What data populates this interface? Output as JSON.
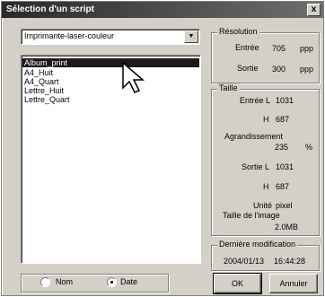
{
  "window": {
    "title": "Sélection d'un script",
    "close": "x"
  },
  "printer": {
    "selected": "Imprimante-laser-couleur"
  },
  "scripts": [
    "Album_print",
    "A4_Huit",
    "A4_Quart",
    "Lettre_Huit",
    "Lettre_Quart"
  ],
  "resolution": {
    "legend": "Résolution",
    "input_label": "Entrée",
    "input_value": "705",
    "input_unit": "ppp",
    "output_label": "Sortie",
    "output_value": "300",
    "output_unit": "ppp"
  },
  "size": {
    "legend": "Taille",
    "input_l_label": "Entrée L",
    "input_l_value": "1031",
    "input_h_label": "H",
    "input_h_value": "687",
    "enlarge_label": "Agrandissement",
    "enlarge_value": "235",
    "enlarge_unit": "%",
    "output_l_label": "Sortie L",
    "output_l_value": "1031",
    "output_h_label": "H",
    "output_h_value": "687",
    "unit_label": "Unité",
    "unit_value": "pixel",
    "image_size_label": "Taille de l'image",
    "image_size_value": "2.0MB"
  },
  "modified": {
    "legend": "Dernière modification",
    "date": "2004/01/13",
    "time": "16:44:28"
  },
  "sort": {
    "name_label": "Nom",
    "date_label": "Date",
    "selected": "Date"
  },
  "buttons": {
    "ok": "OK",
    "cancel": "Annuler"
  }
}
